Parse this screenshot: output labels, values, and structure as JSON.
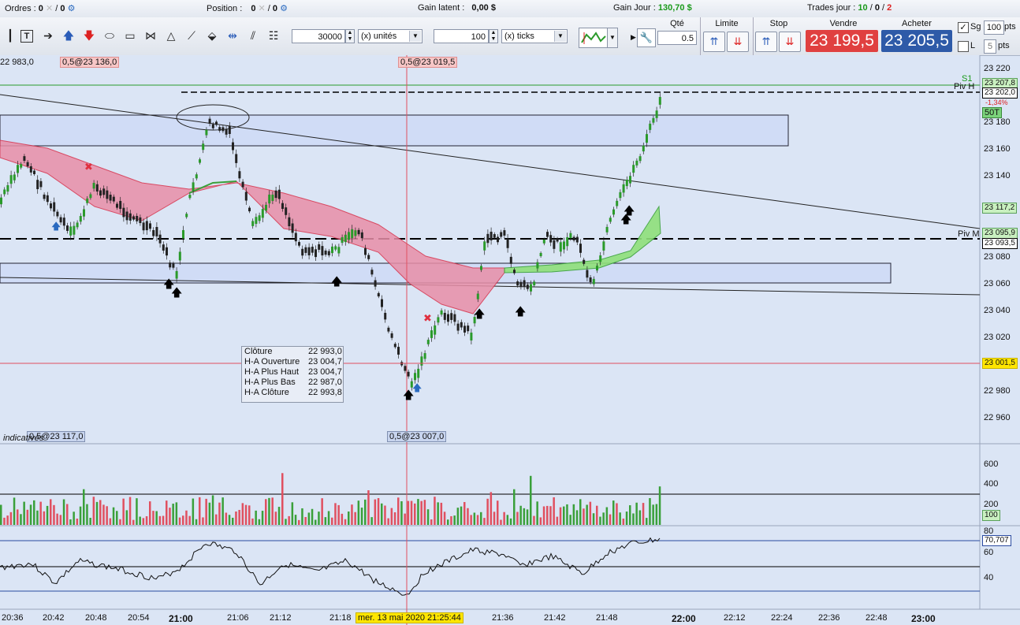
{
  "topbar": {
    "orders_label": "Ordres :",
    "orders_val1": "0",
    "orders_val2": "0",
    "position_label": "Position :",
    "position_val1": "0",
    "position_val2": "0",
    "gain_latent_label": "Gain latent :",
    "gain_latent_val": "0,00 $",
    "gain_jour_label": "Gain Jour :",
    "gain_jour_val": "130,70 $",
    "trades_label": "Trades jour :",
    "trades_a": "10",
    "trades_b": "0",
    "trades_c": "2"
  },
  "toolbar": {
    "qty_units_value": "30000",
    "units_select": "(x) unités",
    "ticks_value": "100",
    "ticks_select": "(x) ticks",
    "qte_label": "Qté",
    "qte_value": "0.5",
    "limite_label": "Limite",
    "stop_label": "Stop",
    "vendre_label": "Vendre",
    "vendre_price": "23 199,5",
    "acheter_label": "Acheter",
    "acheter_price": "23 205,5",
    "sg_label": "Sg",
    "sg_value": "100",
    "pts1": "pts",
    "l_label": "L",
    "l_value": "5",
    "pts2": "pts"
  },
  "chart": {
    "top_left_price": "22 983,0",
    "marker_top_left": "0,5@23 136,0",
    "marker_top_center": "0,5@23 019,5",
    "marker_bottom_left": "0,5@23 117,0",
    "marker_bottom_center": "0,5@23 007,0",
    "indicatives": "indicatives",
    "s1_label": "S1",
    "pivh_label": "Piv H",
    "pivm_label": "Piv M",
    "pct_change": "-1,34%",
    "sot": "50T",
    "price_axis": [
      "23 220",
      "23 180",
      "23 160",
      "23 140",
      "23 080",
      "23 060",
      "23 040",
      "23 020",
      "22 980",
      "22 960"
    ],
    "axis_tags": {
      "t1": "23 207,8",
      "t2": "23 202,0",
      "t3": "23 117,2",
      "t4": "23 095,9",
      "t5": "23 093,5",
      "t6": "23 001,5"
    },
    "volume_axis": [
      "600",
      "400",
      "200"
    ],
    "volume_tag": "100",
    "rsi_axis": [
      "80",
      "60",
      "40"
    ],
    "rsi_tag": "70,707",
    "time_labels": [
      "20:36",
      "20:42",
      "20:48",
      "20:54",
      "21:00",
      "21:06",
      "21:12",
      "21:18",
      "21:36",
      "21:42",
      "21:48",
      "22:00",
      "22:12",
      "22:24",
      "22:36",
      "22:48",
      "23:00"
    ],
    "time_cursor": "mer. 13 mai 2020 21:25:44"
  },
  "tooltip": {
    "cloture_k": "Clôture",
    "cloture_v": "22 993,0",
    "ha_ouv_k": "H-A Ouverture",
    "ha_ouv_v": "23 004,7",
    "ha_haut_k": "H-A Plus Haut",
    "ha_haut_v": "23 004,7",
    "ha_bas_k": "H-A Plus Bas",
    "ha_bas_v": "22 987,0",
    "ha_clo_k": "H-A Clôture",
    "ha_clo_v": "22 993,8"
  },
  "colors": {
    "sell": "#e04040",
    "buy": "#2e5aa8",
    "band_red": "#e88fa8",
    "band_green": "#8fe07a",
    "panel": "#dbe5f5"
  }
}
